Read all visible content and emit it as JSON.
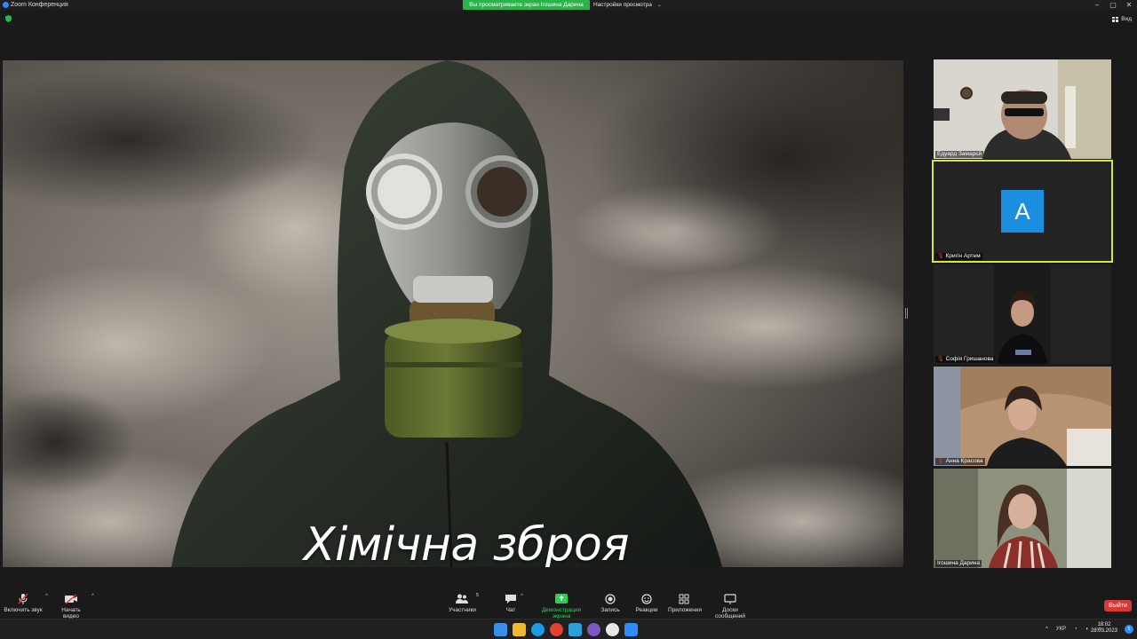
{
  "window": {
    "title": "Zoom Конференция",
    "share_banner": "Вы просматриваете экран Ігошина Дарина",
    "view_settings": "Настройки просмотра",
    "view_button": "Вид"
  },
  "shared_screen": {
    "slide_title": "Хімічна зброя"
  },
  "participants": [
    {
      "name": "Едуард Замарєй",
      "muted": false,
      "video": true
    },
    {
      "name": "Кригін Артем",
      "muted": true,
      "video": false,
      "avatar_letter": "A",
      "active": true
    },
    {
      "name": "Софія Гришанова",
      "muted": true,
      "video": true
    },
    {
      "name": "Анна Красова",
      "muted": true,
      "video": true
    },
    {
      "name": "Ігошина Дарина",
      "muted": false,
      "video": true
    }
  ],
  "toolbar": {
    "unmute": "Включить звук",
    "start_video": "Начать видео",
    "participants": "Участники",
    "participants_count": "5",
    "chat": "Чат",
    "share_screen": "Демонстрация экрана",
    "record": "Запись",
    "reactions": "Реакции",
    "apps": "Приложения",
    "whiteboards": "Доски сообщений",
    "leave": "Выйти"
  },
  "taskbar": {
    "language": "УКР",
    "time": "18:02",
    "date": "28.03.2023",
    "notifications": "5"
  },
  "colors": {
    "share_green": "#2bb44a",
    "active_speaker": "#d6e34a",
    "leave_red": "#d63a35",
    "avatar_blue": "#1a8fe0"
  }
}
